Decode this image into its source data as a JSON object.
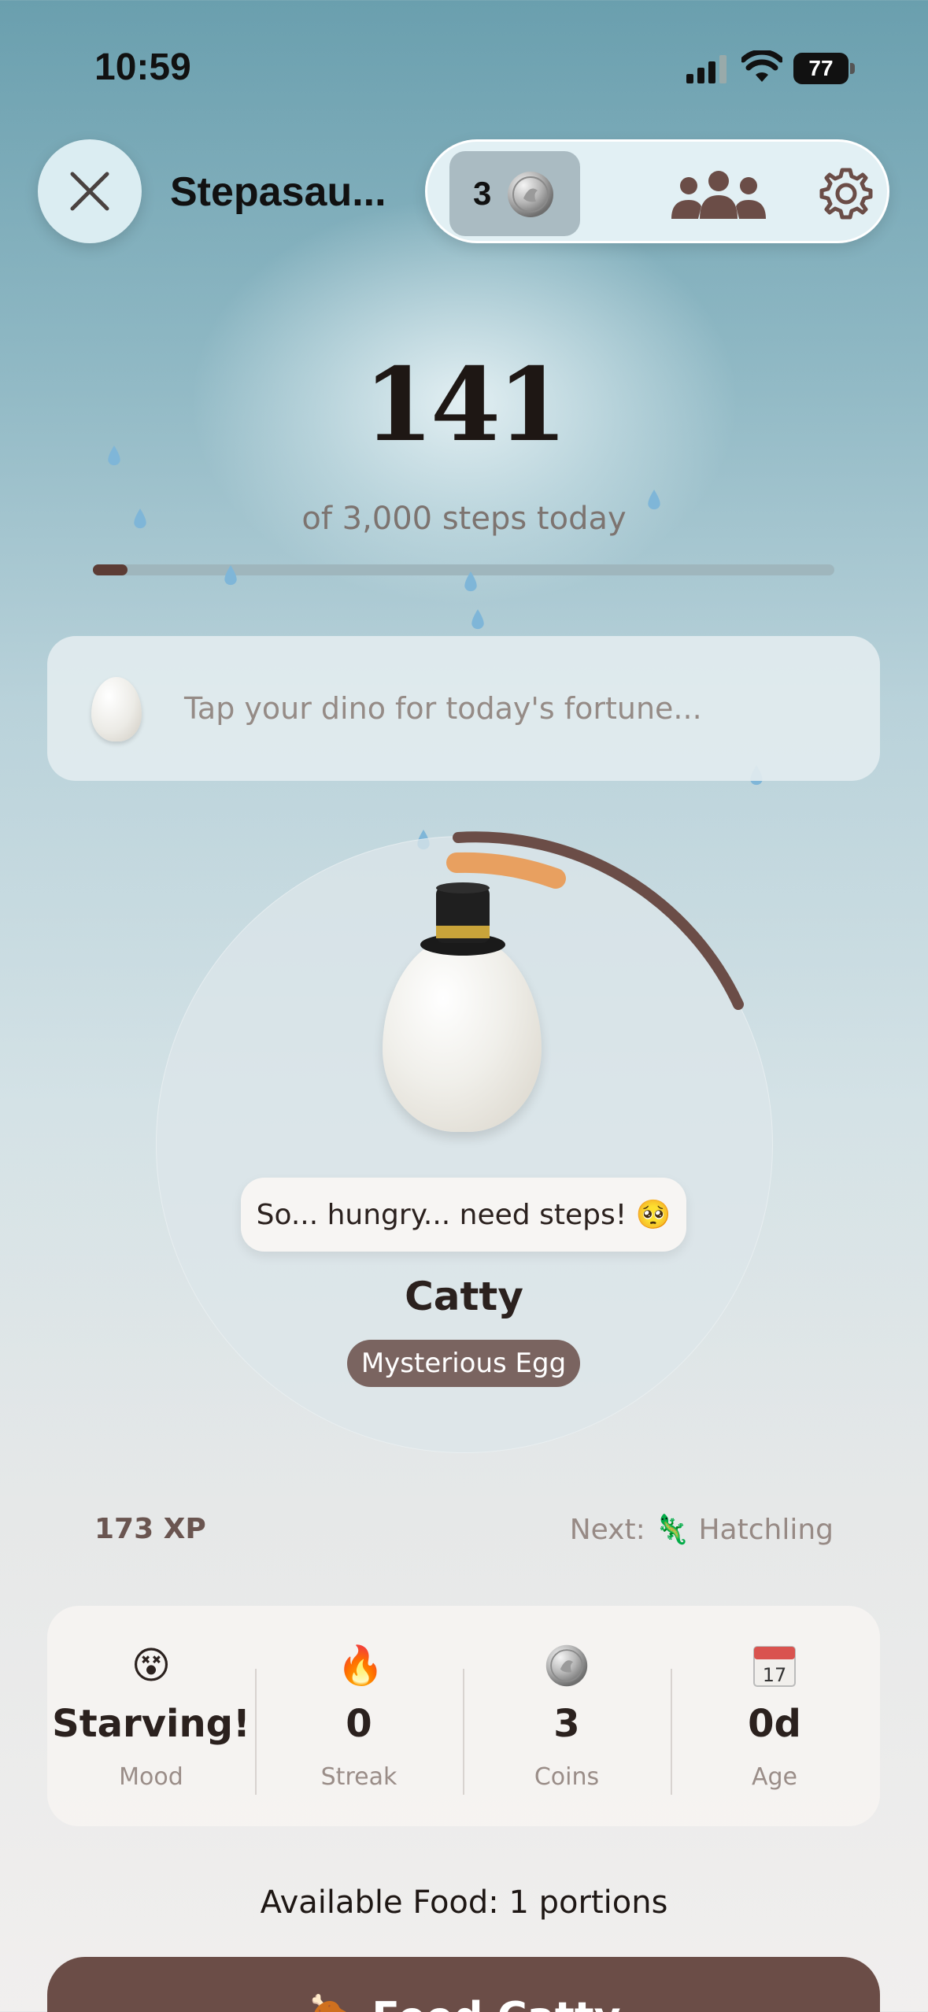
{
  "status_bar": {
    "time": "10:59",
    "battery": "77"
  },
  "header": {
    "pet_name": "Stepasau...",
    "coin_count": "3"
  },
  "steps": {
    "count": "141",
    "subtitle": "of 3,000 steps today",
    "progress": 0.047
  },
  "fortune": {
    "text": "Tap your dino for today's fortune..."
  },
  "pet": {
    "speech": "So... hungry... need steps! 🥺",
    "name": "Catty",
    "stage": "Mysterious Egg"
  },
  "xp": {
    "value": "173 XP",
    "next_prefix": "Next:",
    "next_icon": "🦎",
    "next_stage": "Hatchling"
  },
  "stats": [
    {
      "icon": "😵",
      "value": "Starving!",
      "label": "Mood"
    },
    {
      "icon": "🔥",
      "value": "0",
      "label": "Streak"
    },
    {
      "icon": "coin-icon",
      "value": "3",
      "label": "Coins"
    },
    {
      "icon": "calendar-icon",
      "value": "0d",
      "label": "Age"
    }
  ],
  "food": {
    "text": "Available Food: 1 portions"
  },
  "feed_button": {
    "label": "🍖 Feed Catty"
  },
  "colors": {
    "accent": "#6b4d47",
    "badge": "#7a6460",
    "progress": "#5c3c35",
    "ring_orange": "#e8a060"
  }
}
